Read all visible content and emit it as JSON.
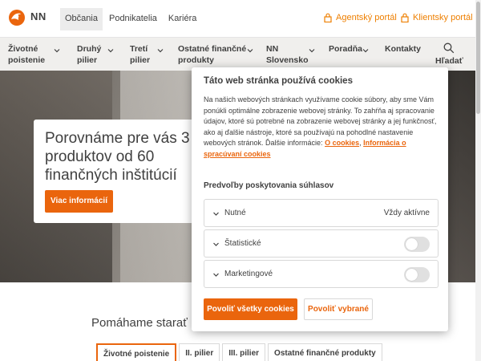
{
  "brand": {
    "name": "NN",
    "accent": "#ea650d",
    "portal_color": "#ee7f00"
  },
  "top_tabs": [
    {
      "label": "Občania",
      "active": true
    },
    {
      "label": "Podnikatelia",
      "active": false
    },
    {
      "label": "Kariéra",
      "active": false
    }
  ],
  "portals": {
    "agent": "Agentský portál",
    "client": "Klientsky portál",
    "icon": "lock-icon"
  },
  "nav": {
    "items": [
      {
        "line1": "Životné",
        "line2": "poistenie"
      },
      {
        "line1": "Druhý",
        "line2": "pilier"
      },
      {
        "line1": "Tretí",
        "line2": "pilier"
      },
      {
        "line1": "Ostatné finančné",
        "line2": "produkty"
      },
      {
        "line1": "NN",
        "line2": "Slovensko"
      },
      {
        "line1": "Poradňa",
        "line2": ""
      },
      {
        "line1": "Kontakty",
        "line2": ""
      }
    ],
    "search_label": "Hľadať"
  },
  "hero": {
    "title": "Porovnáme pre vás 3\nproduktov od 60\nfinančných inštitúcií",
    "button": "Viac informácií"
  },
  "section": {
    "title": "Pomáhame starať",
    "tabs": [
      {
        "label": "Životné poistenie",
        "active": true
      },
      {
        "label": "II. pilier",
        "active": false
      },
      {
        "label": "III. pilier",
        "active": false
      },
      {
        "label": "Ostatné finančné produkty",
        "active": false
      }
    ]
  },
  "cookies": {
    "title": "Táto web stránka používá cookies",
    "text": "Na našich webových stránkach využívame cookie súbory, aby sme Vám ponúkli optimálne zobrazenie webovej stránky. To zahŕňa aj spracovanie údajov, ktoré sú potrebné na zobrazenie webovej stránky a jej funkčnosť, ako aj ďalšie nástroje, ktoré sa používajú na pohodlné nastavenie webových stránok. Ďalšie informácie: ",
    "link1": "O cookies",
    "link2": "Informácia o spracúvaní cookies",
    "subtitle": "Predvoľby poskytovania súhlasov",
    "categories": [
      {
        "label": "Nutné",
        "status": "Vždy aktívne",
        "toggle": null
      },
      {
        "label": "Štatistické",
        "status": "",
        "toggle": false
      },
      {
        "label": "Marketingové",
        "status": "",
        "toggle": false
      }
    ],
    "accept_all": "Povoliť všetky cookies",
    "accept_selected": "Povoliť vybrané"
  }
}
